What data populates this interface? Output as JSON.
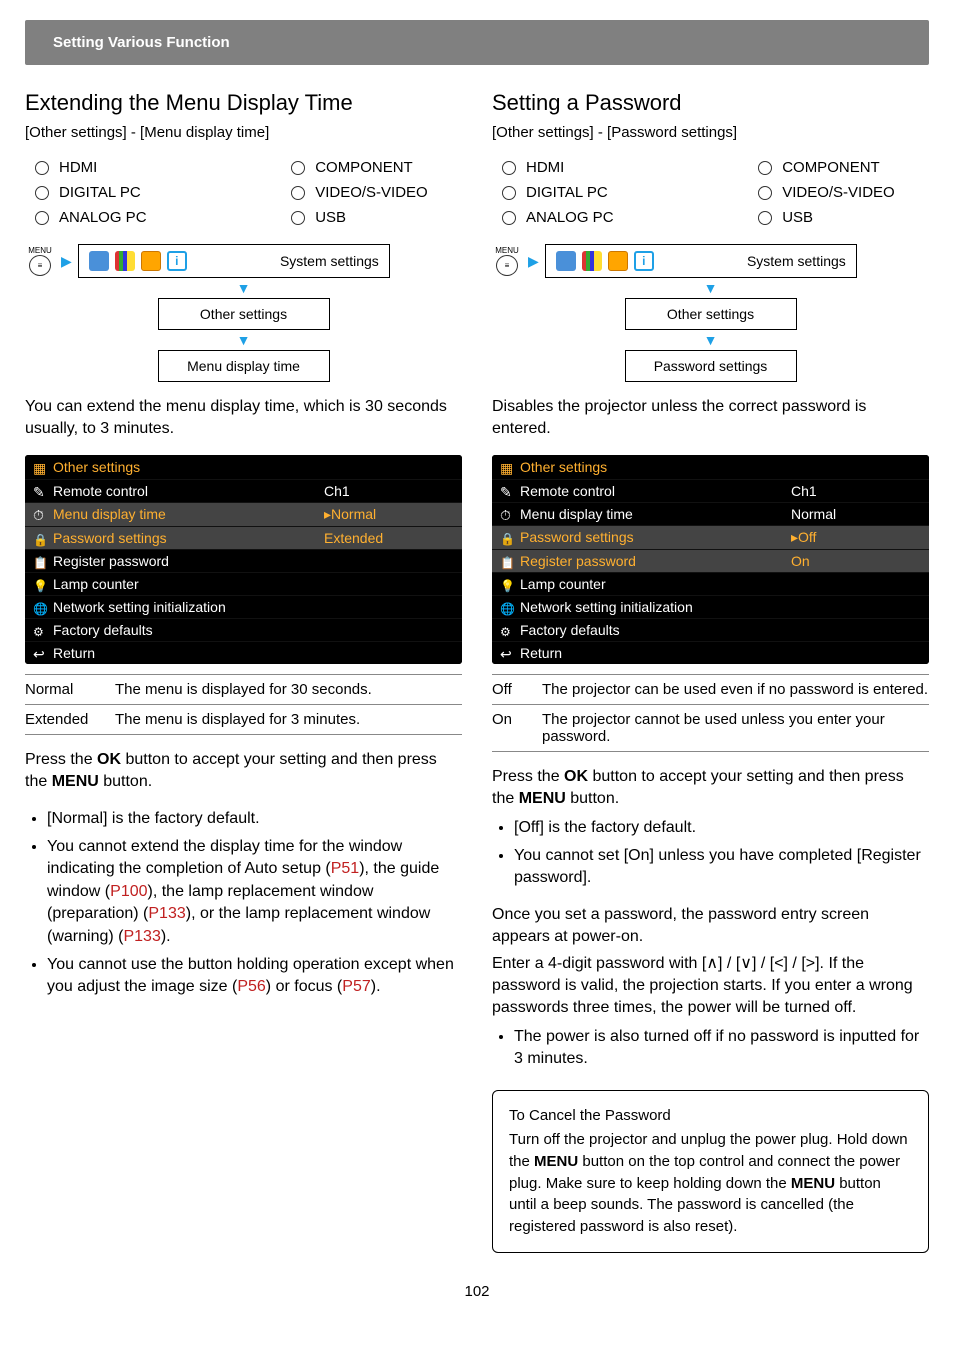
{
  "header": {
    "title": "Setting Various Function"
  },
  "page_number": "102",
  "shared": {
    "inputs": [
      [
        "HDMI",
        "COMPONENT"
      ],
      [
        "DIGITAL PC",
        "VIDEO/S-VIDEO"
      ],
      [
        "ANALOG PC",
        "USB"
      ]
    ],
    "menu_label": "MENU",
    "nav_last": "System settings"
  },
  "left": {
    "heading": "Extending the Menu Display Time",
    "breadcrumb": "[Other settings] - [Menu display time]",
    "path1": "Other settings",
    "path2": "Menu display time",
    "para1": "You can extend the menu display time, which is 30 seconds usually, to 3 minutes.",
    "osd": {
      "title": "Other settings",
      "rows": [
        {
          "label": "Remote control",
          "val": "Ch1",
          "hl": false
        },
        {
          "label": "Menu display time",
          "val": "▸Normal",
          "hl": true
        },
        {
          "label": "Password settings",
          "val": "Extended",
          "hl": true
        },
        {
          "label": "Register password",
          "val": "",
          "hl": false
        },
        {
          "label": "Lamp counter",
          "val": "",
          "hl": false
        },
        {
          "label": "Network setting initialization",
          "val": "",
          "hl": false
        },
        {
          "label": "Factory defaults",
          "val": "",
          "hl": false
        },
        {
          "label": "Return",
          "val": "",
          "hl": false
        }
      ]
    },
    "options": [
      {
        "name": "Normal",
        "desc": "The menu is displayed for 30 seconds."
      },
      {
        "name": "Extended",
        "desc": "The menu is displayed for 3 minutes."
      }
    ],
    "para2_a": "Press the ",
    "para2_b": "OK",
    "para2_c": " button to accept your setting and then press the ",
    "para2_d": "MENU",
    "para2_e": " button.",
    "bullets": [
      "[Normal] is the factory default.",
      "You cannot extend the display time for the window indicating the completion of Auto setup (|P51|), the guide window (|P100|), the lamp replacement window (preparation) (|P133|), or the lamp replacement window (warning) (|P133|).",
      "You cannot use the button holding operation except when you adjust the image size (|P56|) or focus (|P57|)."
    ]
  },
  "right": {
    "heading": "Setting a Password",
    "breadcrumb": "[Other settings] - [Password settings]",
    "path1": "Other settings",
    "path2": "Password settings",
    "para1": "Disables the projector unless the correct password is entered.",
    "osd": {
      "title": "Other settings",
      "rows": [
        {
          "label": "Remote control",
          "val": "Ch1",
          "hl": false
        },
        {
          "label": "Menu display time",
          "val": "Normal",
          "hl": false
        },
        {
          "label": "Password settings",
          "val": "▸Off",
          "hl": true
        },
        {
          "label": "Register password",
          "val": "On",
          "hl": true
        },
        {
          "label": "Lamp counter",
          "val": "",
          "hl": false
        },
        {
          "label": "Network setting initialization",
          "val": "",
          "hl": false
        },
        {
          "label": "Factory defaults",
          "val": "",
          "hl": false
        },
        {
          "label": "Return",
          "val": "",
          "hl": false
        }
      ]
    },
    "options": [
      {
        "name": "Off",
        "desc": "The projector can be used even if no password is entered."
      },
      {
        "name": "On",
        "desc": "The projector cannot be used unless you enter your password."
      }
    ],
    "para2_a": "Press the ",
    "para2_b": "OK",
    "para2_c": " button to accept your setting and then press the ",
    "para2_d": "MENU",
    "para2_e": " button.",
    "bullets": [
      "[Off] is the factory default.",
      "You cannot set [On] unless you have completed [Register password]."
    ],
    "para3": "Once you set a password, the password entry screen appears at power-on.",
    "para4": "Enter a 4-digit password with [∧] / [∨] / [<] / [>]. If the password is valid, the projection starts. If you enter a wrong passwords three times, the power will be turned off.",
    "bullet2": "The power is also turned off if no password is inputted for 3 minutes.",
    "note_title": "To Cancel the Password",
    "note_a": "Turn off the projector and unplug the power plug. Hold down the ",
    "note_b": "MENU",
    "note_c": " button on the top control and connect the power plug. Make sure to keep holding down the ",
    "note_d": "MENU",
    "note_e": " button until a beep sounds. The password is cancelled (the registered password is also reset)."
  }
}
